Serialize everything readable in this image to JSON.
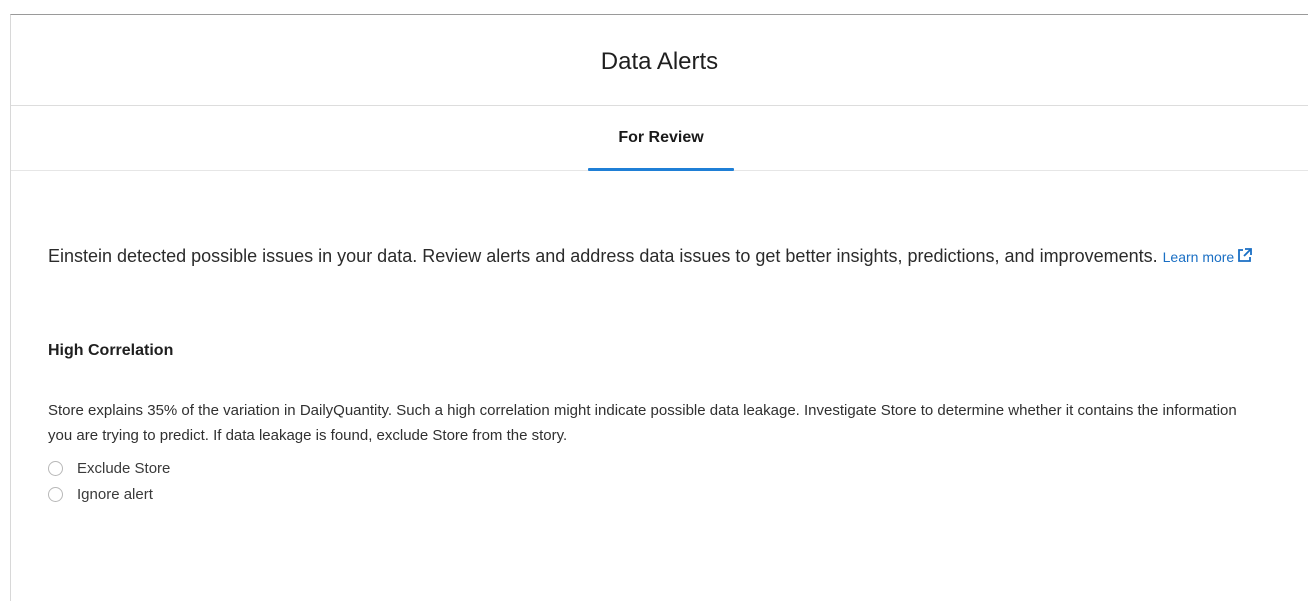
{
  "header": {
    "title": "Data Alerts"
  },
  "tabs": [
    {
      "label": "For Review",
      "active": true
    }
  ],
  "intro": {
    "text": "Einstein detected possible issues in your data. Review alerts and address data issues to get better insights, predictions, and improvements.",
    "link_label": "Learn more",
    "link_icon": "external-link-icon"
  },
  "alert": {
    "title": "High Correlation",
    "description": "Store explains 35% of the variation in DailyQuantity. Such a high correlation might indicate possible data leakage. Investigate Store to determine whether it contains the information you are trying to predict. If data leakage is found, exclude Store from the story.",
    "options": [
      {
        "label": "Exclude Store",
        "selected": false
      },
      {
        "label": "Ignore alert",
        "selected": false
      }
    ]
  },
  "colors": {
    "accent": "#1f7fd6",
    "link": "#1a6fc4"
  }
}
